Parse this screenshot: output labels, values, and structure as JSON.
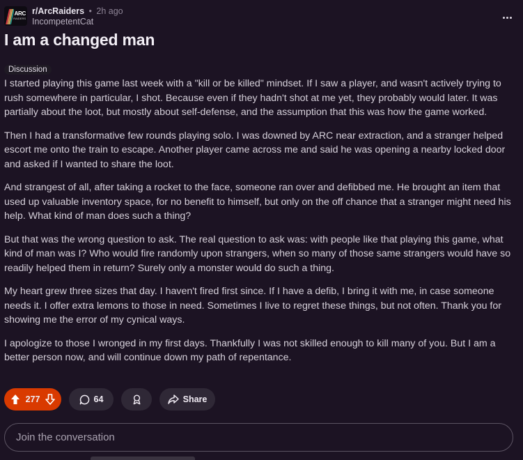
{
  "post": {
    "subreddit": "r/ArcRaiders",
    "separator": "•",
    "time_ago": "2h ago",
    "author": "IncompetentCat",
    "avatar": {
      "text": "ARC",
      "subtext": "RAIDERS",
      "stripe_colors": [
        "#e63946",
        "#f4a261",
        "#e9c46a",
        "#2a9d8f",
        "#4cc9f0"
      ]
    },
    "title": "I am a changed man",
    "flair": "Discussion",
    "paragraphs": [
      "I started playing this game last week with a \"kill or be killed\" mindset. If I saw a player, and wasn't actively trying to rush somewhere in particular, I shot. Because even if they hadn't shot at me yet, they probably would later. It was partially about the loot, but mostly about self-defense, and the assumption that this was how the game worked.",
      "Then I had a transformative few rounds playing solo. I was downed by ARC near extraction, and a stranger helped escort me onto the train to escape. Another player came across me and said he was opening a nearby locked door and asked if I wanted to share the loot.",
      "And strangest of all, after taking a rocket to the face, someone ran over and defibbed me. He brought an item that used up valuable inventory space, for no benefit to himself, but only on the off chance that a stranger might need his help. What kind of man does such a thing?",
      "But that was the wrong question to ask. The real question to ask was: with people like that playing this game, what kind of man was I? Who would fire randomly upon strangers, when so many of those same strangers would have so readily helped them in return? Surely only a monster would do such a thing.",
      "My heart grew three sizes that day. I haven't fired first since. If I have a defib, I bring it with me, in case someone needs it. I offer extra lemons to those in need. Sometimes I live to regret these things, but not often. Thank you for showing me the error of my cynical ways.",
      "I apologize to those I wronged in my first days. Thankfully I was not skilled enough to kill many of you. But I am a better person now, and will continue down my path of repentance."
    ]
  },
  "actions": {
    "upvote_icon": "arrow-up-icon",
    "score": "277",
    "downvote_icon": "arrow-down-icon",
    "comments_icon": "comment-bubble-icon",
    "comments": "64",
    "award_icon": "award-icon",
    "share_icon": "share-arrow-icon",
    "share_label": "Share"
  },
  "comment_box": {
    "placeholder": "Join the conversation"
  },
  "colors": {
    "background": "#1c1323",
    "upvote_active": "#d93a00",
    "pill": "#2f2836"
  }
}
